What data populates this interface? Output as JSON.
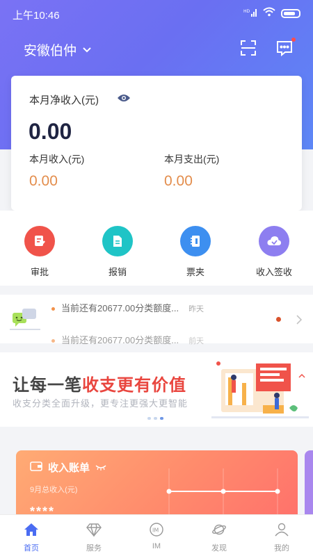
{
  "status": {
    "time": "上午10:46",
    "signal": "HD",
    "icons": [
      "signal-icon",
      "wifi-icon",
      "battery-icon"
    ]
  },
  "header": {
    "company": "安徽伯仲",
    "icons": [
      "chevron-down-icon",
      "scan-icon",
      "message-icon"
    ]
  },
  "summary": {
    "net_label": "本月净收入(元)",
    "net_value": "0.00",
    "income_label": "本月收入(元)",
    "income_value": "0.00",
    "expense_label": "本月支出(元)",
    "expense_value": "0.00"
  },
  "quick_actions": [
    {
      "label": "审批",
      "icon": "approval-icon",
      "color": "#f0534a"
    },
    {
      "label": "报销",
      "icon": "document-icon",
      "color": "#1fc4c6"
    },
    {
      "label": "票夹",
      "icon": "notebook-icon",
      "color": "#3d8ff0"
    },
    {
      "label": "收入签收",
      "icon": "cloud-icon",
      "color": "#8d7ef0"
    }
  ],
  "notices": [
    {
      "text": "当前还有20677.00分类额度...",
      "when": "昨天"
    },
    {
      "text": "当前还有20677.00分类额度...",
      "when": "前天"
    }
  ],
  "banner": {
    "title_plain": "让每一笔",
    "title_highlight": "收支更有价值",
    "subtitle": "收支分类全面升级，更专注更强大更智能"
  },
  "bill_card": {
    "title": "收入账单",
    "subtitle": "9月总收入(元)",
    "amount": "****"
  },
  "tabs": [
    {
      "label": "首页",
      "icon": "home-icon",
      "active": true
    },
    {
      "label": "服务",
      "icon": "diamond-icon",
      "active": false
    },
    {
      "label": "IM",
      "icon": "im-icon",
      "active": false
    },
    {
      "label": "发现",
      "icon": "planet-icon",
      "active": false
    },
    {
      "label": "我的",
      "icon": "user-icon",
      "active": false
    }
  ],
  "colors": {
    "accent": "#4a6cf2",
    "money": "#e38d4c",
    "highlight": "#e9463f"
  }
}
